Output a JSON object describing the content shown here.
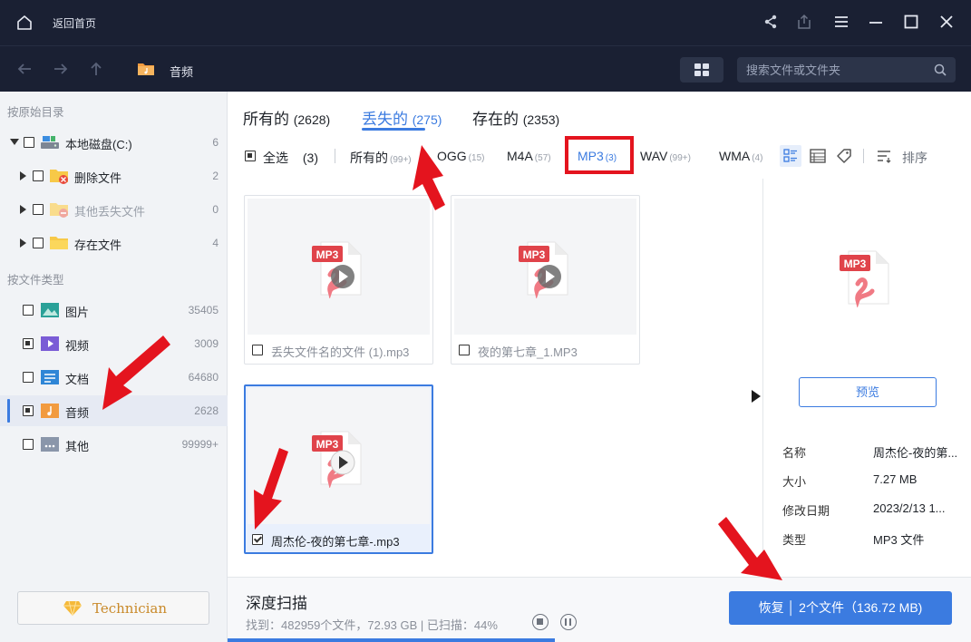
{
  "titlebar": {
    "back_home": "返回首页"
  },
  "navbar": {
    "breadcrumb": "音频",
    "search_placeholder": "搜索文件或文件夹"
  },
  "sidebar": {
    "original_dir_title": "按原始目录",
    "tree": [
      {
        "label": "本地磁盘(C:)",
        "count": "6"
      },
      {
        "label": "删除文件",
        "count": "2"
      },
      {
        "label": "其他丢失文件",
        "count": "0"
      },
      {
        "label": "存在文件",
        "count": "4"
      }
    ],
    "file_type_title": "按文件类型",
    "types": [
      {
        "label": "图片",
        "count": "35405"
      },
      {
        "label": "视频",
        "count": "3009"
      },
      {
        "label": "文档",
        "count": "64680"
      },
      {
        "label": "音频",
        "count": "2628"
      },
      {
        "label": "其他",
        "count": "99999+"
      }
    ],
    "technician_label": "Technician"
  },
  "tabs": [
    {
      "label": "所有的",
      "count": "(2628)"
    },
    {
      "label": "丢失的",
      "count": "(275)"
    },
    {
      "label": "存在的",
      "count": "(2353)"
    }
  ],
  "filters": {
    "select_all": "全选",
    "select_all_count": "(3)",
    "items": [
      {
        "label": "所有的",
        "count": "(99+)"
      },
      {
        "label": "OGG",
        "count": "(15)"
      },
      {
        "label": "M4A",
        "count": "(57)"
      },
      {
        "label": "MP3",
        "count": "(3)"
      },
      {
        "label": "WAV",
        "count": "(99+)"
      },
      {
        "label": "WMA",
        "count": "(4)"
      }
    ],
    "sort_label": "排序"
  },
  "files": [
    {
      "name": "丢失文件名的文件 (1).mp3",
      "badge": "MP3",
      "checked": false
    },
    {
      "name": "夜的第七章_1.MP3",
      "badge": "MP3",
      "checked": false
    },
    {
      "name": "周杰伦-夜的第七章-.mp3",
      "badge": "MP3",
      "checked": true
    }
  ],
  "preview": {
    "badge": "MP3",
    "button": "预览",
    "meta": [
      {
        "key": "名称",
        "value": "周杰伦-夜的第..."
      },
      {
        "key": "大小",
        "value": "7.27 MB"
      },
      {
        "key": "修改日期",
        "value": "2023/2/13 1..."
      },
      {
        "key": "类型",
        "value": "MP3 文件"
      }
    ]
  },
  "bottom": {
    "scan_title": "深度扫描",
    "scan_status": "找到：482959个文件，72.93 GB | 已扫描：44%",
    "scan_progress": 0.44,
    "recover_label": "恢复 │ 2个文件（136.72 MB)"
  },
  "colors": {
    "accent": "#3b7be0",
    "titlebar": "#1a2033",
    "annotation_red": "#e4141e"
  }
}
